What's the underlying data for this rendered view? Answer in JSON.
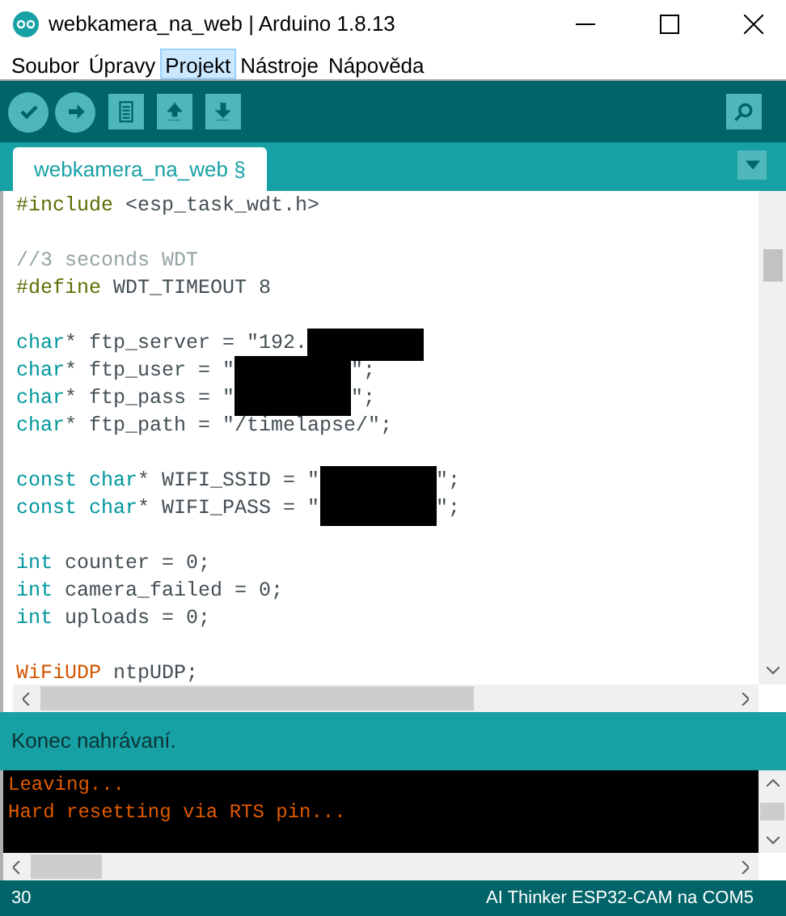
{
  "window": {
    "title": "webkamera_na_web | Arduino 1.8.13"
  },
  "menu": [
    {
      "label": "Soubor",
      "selected": false
    },
    {
      "label": "Úpravy",
      "selected": false
    },
    {
      "label": "Projekt",
      "selected": true
    },
    {
      "label": "Nástroje",
      "selected": false
    },
    {
      "label": "Nápověda",
      "selected": false
    }
  ],
  "toolbar": [
    {
      "kind": "verify"
    },
    {
      "kind": "upload"
    },
    {
      "kind": "new"
    },
    {
      "kind": "open"
    },
    {
      "kind": "save"
    }
  ],
  "tabs": [
    {
      "label": "webkamera_na_web §",
      "selected": true
    }
  ],
  "editor": {
    "lines": [
      {
        "kind": "code",
        "tokens": [
          {
            "kind": "preproc",
            "text": "#include"
          },
          {
            "kind": "plain",
            "text": " <esp_task_wdt.h>"
          }
        ]
      },
      {
        "kind": "blank"
      },
      {
        "kind": "code",
        "tokens": [
          {
            "kind": "comment",
            "text": "//3 seconds WDT"
          }
        ]
      },
      {
        "kind": "code",
        "tokens": [
          {
            "kind": "preproc",
            "text": "#define"
          },
          {
            "kind": "plain",
            "text": " WDT_TIMEOUT 8"
          }
        ]
      },
      {
        "kind": "blank"
      },
      {
        "kind": "code",
        "tokens": [
          {
            "kind": "type",
            "text": "char"
          },
          {
            "kind": "plain",
            "text": "* ftp_server = \"192."
          },
          {
            "kind": "redacted"
          }
        ]
      },
      {
        "kind": "code",
        "tokens": [
          {
            "kind": "type",
            "text": "char"
          },
          {
            "kind": "plain",
            "text": "* ftp_user = \""
          },
          {
            "kind": "redacted"
          },
          {
            "kind": "plain",
            "text": "\";"
          }
        ]
      },
      {
        "kind": "code",
        "tokens": [
          {
            "kind": "type",
            "text": "char"
          },
          {
            "kind": "plain",
            "text": "* ftp_pass = \""
          },
          {
            "kind": "redacted"
          },
          {
            "kind": "plain",
            "text": "\";"
          }
        ]
      },
      {
        "kind": "code",
        "tokens": [
          {
            "kind": "type",
            "text": "char"
          },
          {
            "kind": "plain",
            "text": "* ftp_path = \"/timelapse/\";"
          }
        ]
      },
      {
        "kind": "blank"
      },
      {
        "kind": "code",
        "tokens": [
          {
            "kind": "type",
            "text": "const char"
          },
          {
            "kind": "plain",
            "text": "* WIFI_SSID = \""
          },
          {
            "kind": "redacted"
          },
          {
            "kind": "plain",
            "text": "\";"
          }
        ]
      },
      {
        "kind": "code",
        "tokens": [
          {
            "kind": "type",
            "text": "const char"
          },
          {
            "kind": "plain",
            "text": "* WIFI_PASS = \""
          },
          {
            "kind": "redacted"
          },
          {
            "kind": "plain",
            "text": "\";"
          }
        ]
      },
      {
        "kind": "blank"
      },
      {
        "kind": "code",
        "tokens": [
          {
            "kind": "type",
            "text": "int"
          },
          {
            "kind": "plain",
            "text": " counter = 0;"
          }
        ]
      },
      {
        "kind": "code",
        "tokens": [
          {
            "kind": "type",
            "text": "int"
          },
          {
            "kind": "plain",
            "text": " camera_failed = 0;"
          }
        ]
      },
      {
        "kind": "code",
        "tokens": [
          {
            "kind": "type",
            "text": "int"
          },
          {
            "kind": "plain",
            "text": " uploads = 0;"
          }
        ]
      },
      {
        "kind": "blank"
      },
      {
        "kind": "code",
        "tokens": [
          {
            "kind": "class",
            "text": "WiFiUDP"
          },
          {
            "kind": "plain",
            "text": " ntpUDP;"
          }
        ]
      }
    ]
  },
  "status_message": "Konec nahrávaní.",
  "console": [
    "Leaving...",
    "Hard resetting via RTS pin..."
  ],
  "status_bar": {
    "line": "30",
    "board": "AI Thinker ESP32-CAM na COM5"
  }
}
